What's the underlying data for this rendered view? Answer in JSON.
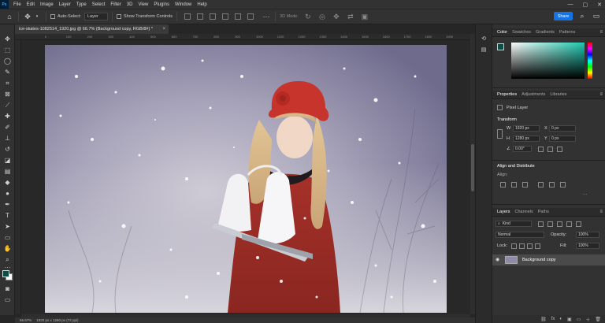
{
  "app": {
    "logo": "Ps",
    "menu": [
      "File",
      "Edit",
      "Image",
      "Layer",
      "Type",
      "Select",
      "Filter",
      "3D",
      "View",
      "Plugins",
      "Window",
      "Help"
    ],
    "window_controls": [
      "—",
      "▢",
      "✕"
    ]
  },
  "options_bar": {
    "auto_select_label": "Auto-Select:",
    "auto_select_value": "Layer",
    "show_transform_label": "Show Transform Controls",
    "mode_label": "3D Mode:",
    "share_label": "Share"
  },
  "document": {
    "tab_title": "ice-skates-1082514_1920.jpg @ 66.7% (Background copy, RGB/8#) *",
    "tab_close": "×",
    "ruler_ticks": [
      "0",
      "100",
      "200",
      "300",
      "400",
      "500",
      "600",
      "700",
      "800",
      "900",
      "1000",
      "1100",
      "1200",
      "1300",
      "1400",
      "1500",
      "1600",
      "1700",
      "1800",
      "1900"
    ],
    "zoom": "66.67%",
    "status": "1920 px x 1280 px (72 ppi)"
  },
  "color_panel": {
    "tabs": [
      "Color",
      "Swatches",
      "Gradients",
      "Patterns"
    ],
    "foreground": "#0f4c45",
    "background": "#ffffff"
  },
  "properties_panel": {
    "tabs": [
      "Properties",
      "Adjustments",
      "Libraries"
    ],
    "layer_type": "Pixel Layer",
    "transform_title": "Transform",
    "w_label": "W",
    "w_value": "1920 px",
    "h_label": "H",
    "h_value": "1280 px",
    "x_label": "X",
    "x_value": "0 px",
    "y_label": "Y",
    "y_value": "0 px",
    "angle_value": "0.00°",
    "align_title": "Align and Distribute",
    "align_label": "Align:"
  },
  "layers_panel": {
    "tabs": [
      "Layers",
      "Channels",
      "Paths"
    ],
    "kind_label": "Kind",
    "blend_mode": "Normal",
    "opacity_label": "Opacity:",
    "opacity_value": "100%",
    "lock_label": "Lock:",
    "fill_label": "Fill:",
    "fill_value": "100%",
    "layer_name": "Background copy",
    "bottom_icons": [
      "fx",
      "◐",
      "▣",
      "▭",
      "＋",
      "🗑"
    ]
  }
}
